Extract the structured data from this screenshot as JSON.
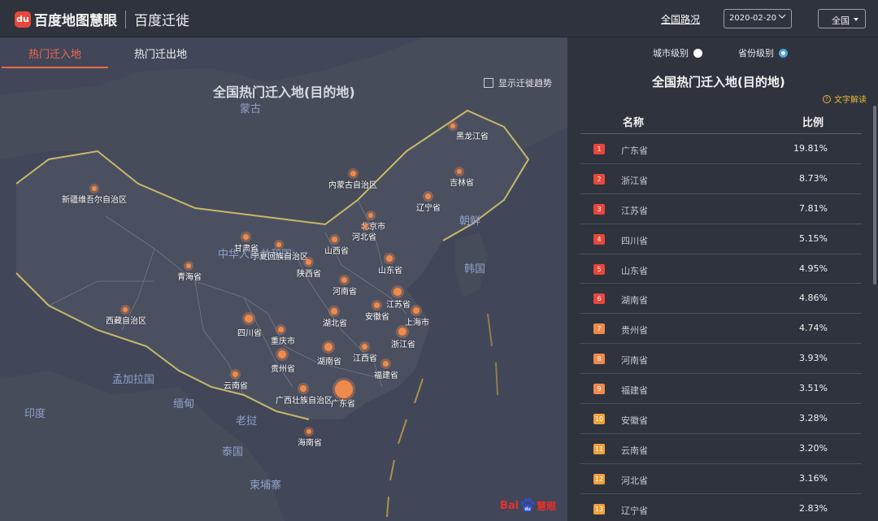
{
  "header": {
    "logo_badge": "du",
    "logo_text": "百度地图慧眼",
    "product": "百度迁徙",
    "nav_link": "全国路况",
    "date": "2020-02-20",
    "region": "全国"
  },
  "map": {
    "tabs": [
      {
        "label": "热门迁入地",
        "active": true
      },
      {
        "label": "热门迁出地",
        "active": false
      }
    ],
    "title": "全国热门迁入地(目的地)",
    "trend_label": "显示迁徙趋势",
    "brand": {
      "part1": "Bai",
      "part2": "du",
      "part3": "慧眼"
    },
    "countries": [
      "蒙古",
      "朝鲜",
      "韩国",
      "中华人民共和国",
      "印度",
      "孟加拉国",
      "缅甸",
      "老挝",
      "泰国",
      "柬埔寨"
    ],
    "provinces": [
      "黑龙江省",
      "吉林省",
      "辽宁省",
      "内蒙古自治区",
      "北京市",
      "河北省",
      "新疆维吾尔自治区",
      "山西省",
      "甘肃省",
      "宁夏回族自治区",
      "山东省",
      "陕西省",
      "青海省",
      "河南省",
      "江苏省",
      "安徽省",
      "上海市",
      "西藏自治区",
      "湖北省",
      "四川省",
      "重庆市",
      "浙江省",
      "江西省",
      "湖南省",
      "贵州省",
      "福建省",
      "云南省",
      "广西壮族自治区",
      "广东省",
      "海南省"
    ]
  },
  "panel": {
    "level_city": "城市级别",
    "level_province": "省份级别",
    "selected_level": "省份级别",
    "title": "全国热门迁入地(目的地)",
    "read_link": "文字解读",
    "col_name": "名称",
    "col_ratio": "比例",
    "rows": [
      {
        "rank": "1",
        "name": "广东省",
        "ratio": "19.81%"
      },
      {
        "rank": "2",
        "name": "浙江省",
        "ratio": "8.73%"
      },
      {
        "rank": "3",
        "name": "江苏省",
        "ratio": "7.81%"
      },
      {
        "rank": "4",
        "name": "四川省",
        "ratio": "5.15%"
      },
      {
        "rank": "5",
        "name": "山东省",
        "ratio": "4.95%"
      },
      {
        "rank": "6",
        "name": "湖南省",
        "ratio": "4.86%"
      },
      {
        "rank": "7",
        "name": "贵州省",
        "ratio": "4.74%"
      },
      {
        "rank": "8",
        "name": "河南省",
        "ratio": "3.93%"
      },
      {
        "rank": "9",
        "name": "福建省",
        "ratio": "3.51%"
      },
      {
        "rank": "10",
        "name": "安徽省",
        "ratio": "3.28%"
      },
      {
        "rank": "11",
        "name": "云南省",
        "ratio": "3.20%"
      },
      {
        "rank": "12",
        "name": "河北省",
        "ratio": "3.16%"
      },
      {
        "rank": "13",
        "name": "辽宁省",
        "ratio": "2.83%"
      }
    ],
    "rank_colors": [
      "#e8473b",
      "#e8473b",
      "#e8473b",
      "#e8473b",
      "#e8473b",
      "#e8473b",
      "#f08a4b",
      "#f08a4b",
      "#f08a4b",
      "#f0a13b",
      "#f0a13b",
      "#f0a13b",
      "#f0a13b"
    ]
  }
}
